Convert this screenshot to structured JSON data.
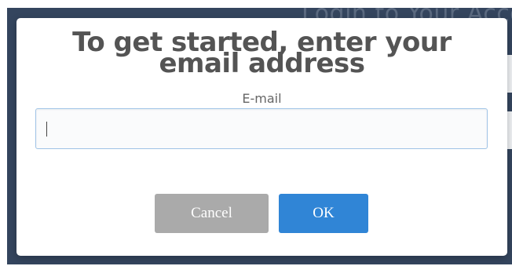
{
  "background": {
    "title": "Login to Your Acco"
  },
  "dialog": {
    "title": "To get started, enter your email address",
    "email_label": "E-mail",
    "email_value": "",
    "cancel_label": "Cancel",
    "ok_label": "OK"
  },
  "colors": {
    "backdrop": "#34455e",
    "confirm_button": "#3085d6",
    "cancel_button": "#aaaaaa",
    "input_focus_border": "#9fc3e6",
    "title_text": "#545454"
  }
}
